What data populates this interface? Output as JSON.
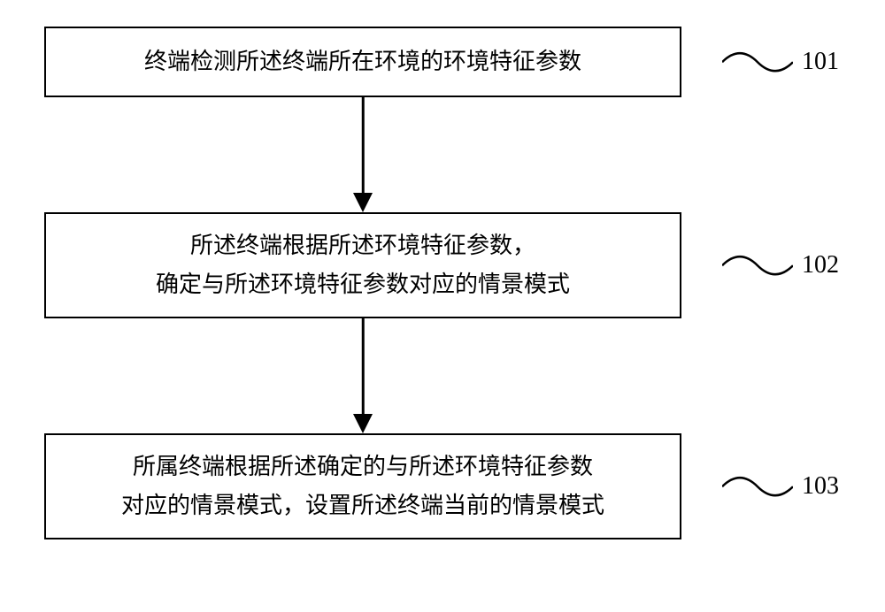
{
  "flowchart": {
    "steps": [
      {
        "id": "101",
        "text_line1": "终端检测所述终端所在环境的环境特征参数",
        "text_line2": ""
      },
      {
        "id": "102",
        "text_line1": "所述终端根据所述环境特征参数，",
        "text_line2": "确定与所述环境特征参数对应的情景模式"
      },
      {
        "id": "103",
        "text_line1": "所属终端根据所述确定的与所述环境特征参数",
        "text_line2": "对应的情景模式，设置所述终端当前的情景模式"
      }
    ]
  }
}
